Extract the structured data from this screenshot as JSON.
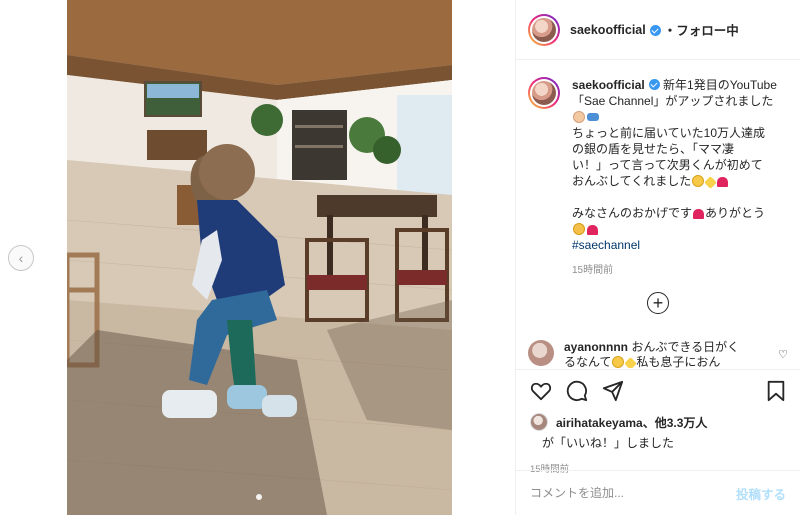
{
  "post": {
    "username": "saekoofficial",
    "follow_status": "・フォロー中",
    "caption_lines": [
      "新年1発目のYouTube",
      "「Sae Channel」がアップされました",
      "ちょっと前に届いていた10万人達成",
      "の銀の盾を見せたら、「ママ凄",
      "い！」って言って次男くんが初めて",
      "おんぶしてくれました"
    ],
    "caption_thanks_a": "みなさんのおかげです",
    "caption_thanks_b": "ありがとう",
    "hashtag": "#saechannel",
    "caption_time": "15時間前",
    "carousel_slides": 2,
    "carousel_current": 2
  },
  "comment": {
    "username": "ayanonnnn",
    "text_a": "おんぶできる日がく",
    "text_b": "るなんて",
    "text_c": "私も息子におん"
  },
  "likes": {
    "user": "airihatakeyama",
    "others": "、他3.3万人",
    "line2": "が「いいね！」しました"
  },
  "post_time": "15時間前",
  "comment_box": {
    "placeholder": "コメントを追加...",
    "post_label": "投稿する"
  },
  "icons": {
    "like": "heart-icon",
    "comment": "comment-icon",
    "share": "share-icon",
    "save": "bookmark-icon",
    "more": "plus-circle-icon",
    "prev": "chevron-left-icon"
  },
  "colors": {
    "verified": "#3897f0",
    "hashtag": "#00376b",
    "post_button": "#b2dffc"
  }
}
